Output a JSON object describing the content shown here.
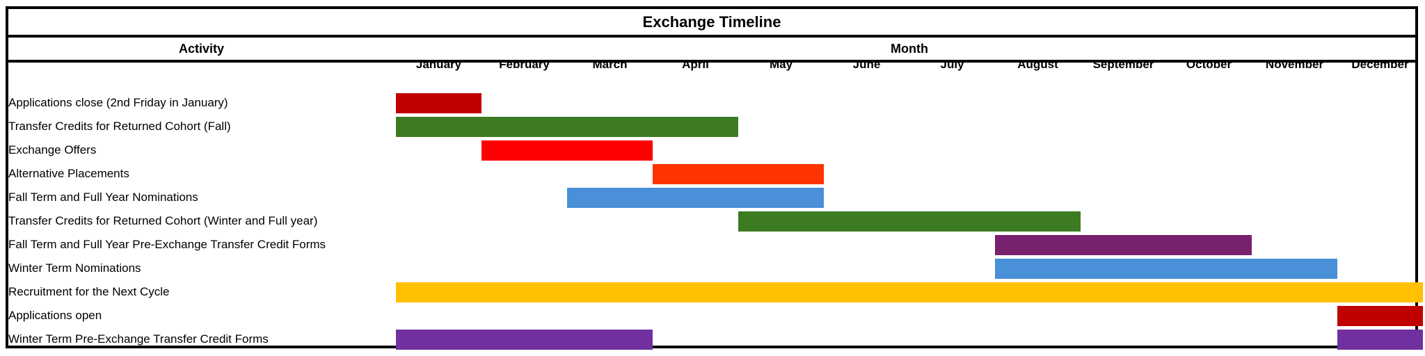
{
  "chart_data": {
    "type": "gantt",
    "title": "Exchange Timeline",
    "column_headers": {
      "activity": "Activity",
      "month": "Month"
    },
    "months": [
      "January",
      "February",
      "March",
      "April",
      "May",
      "June",
      "July",
      "August",
      "September",
      "October",
      "November",
      "December"
    ],
    "tasks": [
      {
        "name": "Applications close (2nd Friday in January)",
        "segments": [
          [
            1,
            1
          ]
        ],
        "color": "#C00000"
      },
      {
        "name": "Transfer Credits for Returned Cohort (Fall)",
        "segments": [
          [
            1,
            4
          ]
        ],
        "color": "#3D7B22"
      },
      {
        "name": "Exchange Offers",
        "segments": [
          [
            2,
            3
          ]
        ],
        "color": "#FF0000"
      },
      {
        "name": "Alternative Placements",
        "segments": [
          [
            4,
            5
          ]
        ],
        "color": "#FF3300"
      },
      {
        "name": "Fall Term and Full Year Nominations",
        "segments": [
          [
            3,
            5
          ]
        ],
        "color": "#4A90D9"
      },
      {
        "name": "Transfer Credits for Returned Cohort (Winter and Full year)",
        "segments": [
          [
            5,
            8
          ]
        ],
        "color": "#3D7B22"
      },
      {
        "name": "Fall Term and Full Year Pre-Exchange Transfer Credit Forms",
        "segments": [
          [
            8,
            10
          ]
        ],
        "color": "#78216F"
      },
      {
        "name": "Winter Term Nominations",
        "segments": [
          [
            8,
            11
          ]
        ],
        "color": "#4A90D9"
      },
      {
        "name": "Recruitment for the Next Cycle",
        "segments": [
          [
            1,
            12
          ]
        ],
        "color": "#FFC000"
      },
      {
        "name": "Applications open",
        "segments": [
          [
            12,
            12
          ]
        ],
        "color": "#C00000"
      },
      {
        "name": "Winter Term Pre-Exchange Transfer Credit Forms",
        "segments": [
          [
            1,
            3
          ],
          [
            12,
            12
          ]
        ],
        "color": "#7030A0"
      }
    ]
  }
}
